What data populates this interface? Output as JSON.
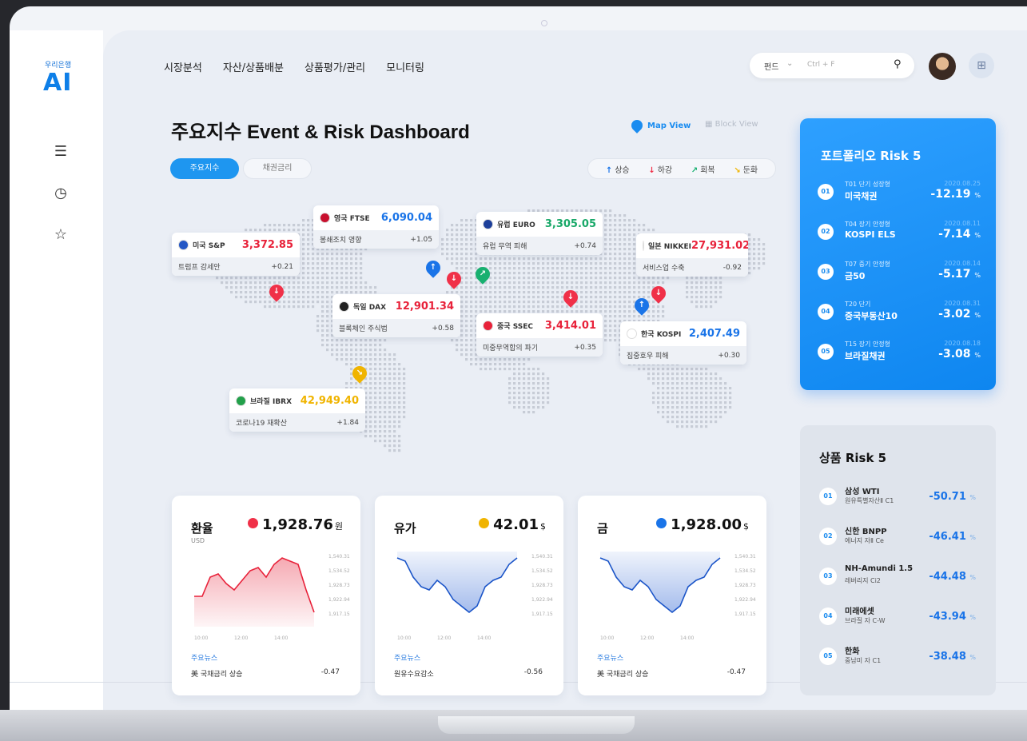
{
  "brand": {
    "sub": "우리은행",
    "name": "AI"
  },
  "sidebar": {
    "icons": [
      "menu-icon",
      "clock-icon",
      "star-icon"
    ]
  },
  "nav": {
    "items": [
      "시장분석",
      "자산/상품배분",
      "상품평가/관리",
      "모니터링"
    ]
  },
  "search": {
    "scope": "펀드",
    "placeholder": "Ctrl + F"
  },
  "page": {
    "title": "주요지수 Event & Risk Dashboard",
    "map_view": "Map View",
    "block_view": "Block View",
    "tabs": [
      "주요지수",
      "채권금리"
    ],
    "legend": [
      {
        "icon": "↑",
        "label": "상승",
        "color": "#1a74e8"
      },
      {
        "icon": "↓",
        "label": "하강",
        "color": "#f03048"
      },
      {
        "icon": "↗",
        "label": "회복",
        "color": "#18b070"
      },
      {
        "icon": "↘",
        "label": "둔화",
        "color": "#f0b400"
      }
    ]
  },
  "indices": [
    {
      "name": "미국 S&P",
      "value": "3,372.85",
      "event": "트럼프 감세안",
      "change": "+0.21",
      "color": "#e8223a",
      "flag": "#2457c5"
    },
    {
      "name": "영국 FTSE",
      "value": "6,090.04",
      "event": "봉쇄조치 영향",
      "change": "+1.05",
      "color": "#1a74e8",
      "flag": "#c8102e"
    },
    {
      "name": "유럽 EURO",
      "value": "3,305.05",
      "event": "유럽 무역 피해",
      "change": "+0.74",
      "color": "#18a868",
      "flag": "#1d3f9a"
    },
    {
      "name": "일본 NIKKEI",
      "value": "27,931.02",
      "event": "서비스업 수축",
      "change": "-0.92",
      "color": "#e8223a",
      "flag": "#e8223a"
    },
    {
      "name": "독일 DAX",
      "value": "12,901.34",
      "event": "블록체인 주식법",
      "change": "+0.58",
      "color": "#e8223a",
      "flag": "#222222"
    },
    {
      "name": "중국 SSEC",
      "value": "3,414.01",
      "event": "미중무역합의 파기",
      "change": "+0.35",
      "color": "#e8223a",
      "flag": "#e8223a"
    },
    {
      "name": "한국 KOSPI",
      "value": "2,407.49",
      "event": "집중호우 피해",
      "change": "+0.30",
      "color": "#1a74e8",
      "flag": "#ffffff"
    },
    {
      "name": "브라질 IBRX",
      "value": "42,949.40",
      "event": "코로나19 재확산",
      "change": "+1.84",
      "color": "#f0b400",
      "flag": "#22a04a"
    }
  ],
  "minis": [
    {
      "title": "환율",
      "unit_label": "USD",
      "value": "1,928.76",
      "unit": "원",
      "dot": "#f03048",
      "fill": "#f4a0aa",
      "line": "#e8223a",
      "yticks": [
        "1,540.31",
        "1,534.52",
        "1,928.73",
        "1,922.94",
        "1,917.15"
      ],
      "xticks": [
        "10:00",
        "12:00",
        "14:00"
      ],
      "news_label": "주요뉴스",
      "news": "美 국채금리 상승",
      "news_change": "-0.47"
    },
    {
      "title": "유가",
      "unit_label": "",
      "value": "42.01",
      "unit": "$",
      "dot": "#f0b400",
      "fill": "#9ab4ea",
      "line": "#1a54c8",
      "yticks": [
        "1,540.31",
        "1,534.52",
        "1,928.73",
        "1,922.94",
        "1,917.15"
      ],
      "xticks": [
        "10:00",
        "12:00",
        "14:00"
      ],
      "news_label": "주요뉴스",
      "news": "원유수요감소",
      "news_change": "-0.56"
    },
    {
      "title": "금",
      "unit_label": "",
      "value": "1,928.00",
      "unit": "$",
      "dot": "#1a74e8",
      "fill": "#9ab4ea",
      "line": "#1a54c8",
      "yticks": [
        "1,540.31",
        "1,534.52",
        "1,928.73",
        "1,922.94",
        "1,917.15"
      ],
      "xticks": [
        "10:00",
        "12:00",
        "14:00"
      ],
      "news_label": "주요뉴스",
      "news": "美 국채금리 상승",
      "news_change": "-0.47"
    }
  ],
  "portfolio_risk": {
    "title": "포트폴리오 Risk 5",
    "items": [
      {
        "num": "01",
        "l1": "T01 단기 성장형",
        "l2": "미국채권",
        "date": "2020.08.25",
        "pct": "-12.19"
      },
      {
        "num": "02",
        "l1": "T04 장기 안정형",
        "l2": "KOSPI ELS",
        "date": "2020.08.11",
        "pct": "-7.14"
      },
      {
        "num": "03",
        "l1": "T07 중기 안정형",
        "l2": "금50",
        "date": "2020.08.14",
        "pct": "-5.17"
      },
      {
        "num": "04",
        "l1": "T20 단기",
        "l2": "중국부동산10",
        "date": "2020.08.31",
        "pct": "-3.02"
      },
      {
        "num": "05",
        "l1": "T15 장기 안정형",
        "l2": "브라질채권",
        "date": "2020.08.18",
        "pct": "-3.08"
      }
    ],
    "pct_unit": "%"
  },
  "product_risk": {
    "title": "상품 Risk 5",
    "items": [
      {
        "num": "01",
        "l1": "삼성 WTI",
        "l2": "원유특별자산Ⅱ C1",
        "pct": "-50.71"
      },
      {
        "num": "02",
        "l1": "신한 BNPP",
        "l2": "에너지 자Ⅱ Ce",
        "pct": "-46.41"
      },
      {
        "num": "03",
        "l1": "NH-Amundi 1.5",
        "l2": "레버리지 Ci2",
        "pct": "-44.48"
      },
      {
        "num": "04",
        "l1": "미래에셋",
        "l2": "브라질 자 C-W",
        "pct": "-43.94"
      },
      {
        "num": "05",
        "l1": "한화",
        "l2": "중남미 자 C1",
        "pct": "-38.48"
      }
    ],
    "pct_unit": "%"
  }
}
